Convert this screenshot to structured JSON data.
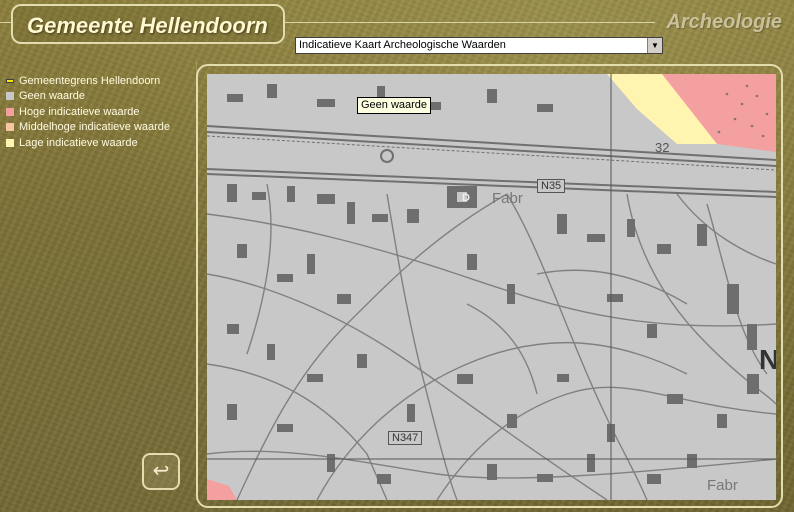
{
  "header": {
    "title": "Gemeente Hellendoorn",
    "section": "Archeologie"
  },
  "map_select": {
    "selected": "Indicatieve Kaart Archeologische Waarden"
  },
  "legend": {
    "items": [
      {
        "label": "Gemeentegrens Hellendoorn",
        "color": "#f5e800",
        "border": "#404040"
      },
      {
        "label": "Geen waarde",
        "color": "#c8c8c8",
        "border": "#c8c8c8"
      },
      {
        "label": "Hoge indicatieve waarde",
        "color": "#f4a0a0",
        "border": "#f4a0a0"
      },
      {
        "label": "Middelhoge indicatieve waarde",
        "color": "#f5c6a0",
        "border": "#f5c6a0"
      },
      {
        "label": "Lage indicatieve waarde",
        "color": "#fff5b0",
        "border": "#fff5b0"
      }
    ]
  },
  "map": {
    "tooltip": "Geen waarde",
    "labels": {
      "n35": "N35",
      "n347": "N347",
      "fabr_top": "Fabr",
      "fabr_bottom": "Fabr",
      "road_32": "32",
      "letter_n": "N",
      "letter_d": "D"
    }
  },
  "controls": {
    "back_icon": "return-arrow-icon"
  }
}
